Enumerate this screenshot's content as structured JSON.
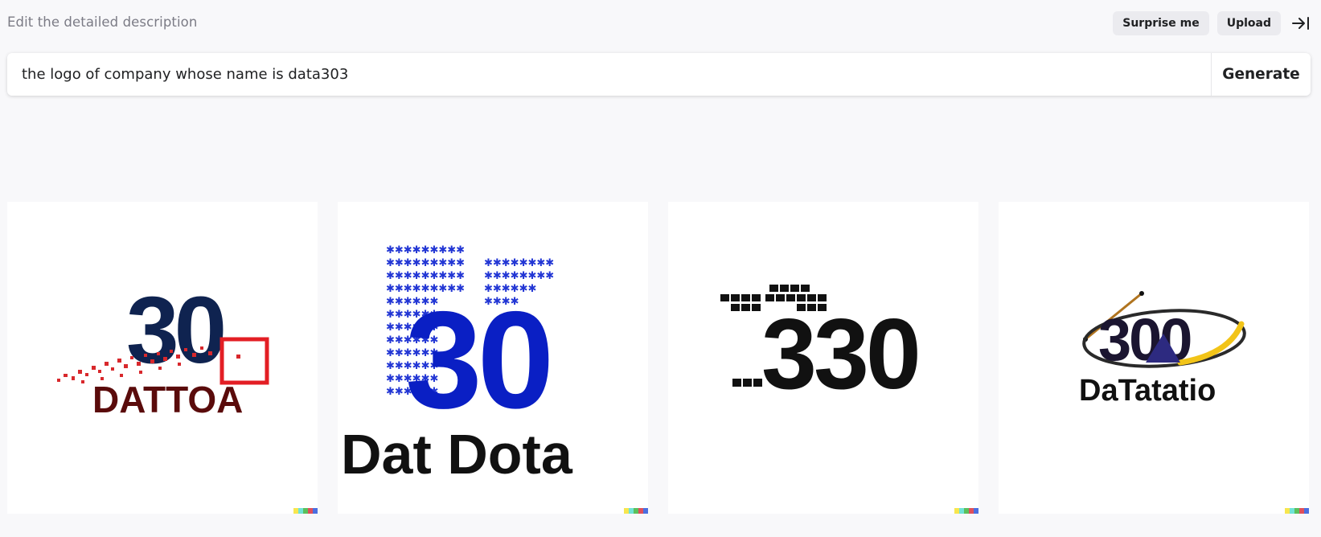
{
  "header": {
    "hint": "Edit the detailed description",
    "surprise_label": "Surprise me",
    "upload_label": "Upload",
    "collapse_icon": "arrow-right-to-bar-icon"
  },
  "prompt": {
    "value": "the logo of company whose name is data303",
    "generate_label": "Generate"
  },
  "results": [
    {
      "main_text": "30",
      "sub_text": "DATTOA",
      "colors": [
        "#0f2350",
        "#e31e24",
        "#5a0b0b"
      ]
    },
    {
      "main_text": "30",
      "sub_text": "Dat Dota",
      "colors": [
        "#0a1fc4",
        "#111111"
      ]
    },
    {
      "main_text": "330",
      "sub_text": "",
      "colors": [
        "#111111"
      ]
    },
    {
      "main_text": "300",
      "sub_text": "DaTatatio",
      "colors": [
        "#1b1530",
        "#f2c418",
        "#2d2a80",
        "#b0741f"
      ]
    }
  ],
  "signature_colors": [
    "#f7e64e",
    "#6fe3d6",
    "#5bc05b",
    "#e0505a",
    "#4b6fe0"
  ]
}
